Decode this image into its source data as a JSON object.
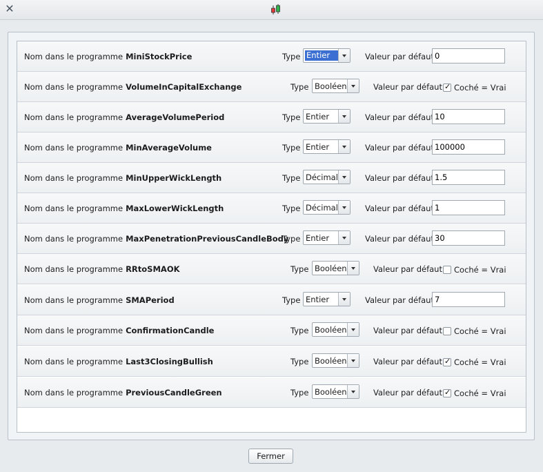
{
  "window": {
    "close_icon": "close-x-icon",
    "app_icon": "candlestick-icon"
  },
  "labels": {
    "name_prefix": "Nom dans le programme",
    "type": "Type",
    "default": "Valeur par défaut",
    "checked_true": "Coché = Vrai"
  },
  "colors": {
    "selection": "#3b6fd1",
    "candle_green": "#2fb34a",
    "candle_red": "#e23b3b"
  },
  "rows": [
    {
      "name": "MiniStockPrice",
      "type": "Entier",
      "value": "0",
      "checked": null,
      "focused": true
    },
    {
      "name": "VolumeInCapitalExchange",
      "type": "Booléen",
      "value": "",
      "checked": true
    },
    {
      "name": "AverageVolumePeriod",
      "type": "Entier",
      "value": "10",
      "checked": null
    },
    {
      "name": "MinAverageVolume",
      "type": "Entier",
      "value": "100000",
      "checked": null
    },
    {
      "name": "MinUpperWickLength",
      "type": "Décimal",
      "value": "1.5",
      "checked": null
    },
    {
      "name": "MaxLowerWickLength",
      "type": "Décimal",
      "value": "1",
      "checked": null
    },
    {
      "name": "MaxPenetrationPreviousCandleBody",
      "type": "Entier",
      "value": "30",
      "checked": null
    },
    {
      "name": "RRtoSMAOK",
      "type": "Booléen",
      "value": "",
      "checked": false
    },
    {
      "name": "SMAPeriod",
      "type": "Entier",
      "value": "7",
      "checked": null
    },
    {
      "name": "ConfirmationCandle",
      "type": "Booléen",
      "value": "",
      "checked": false
    },
    {
      "name": "Last3ClosingBullish",
      "type": "Booléen",
      "value": "",
      "checked": true
    },
    {
      "name": "PreviousCandleGreen",
      "type": "Booléen",
      "value": "",
      "checked": true
    }
  ],
  "footer": {
    "close_button": "Fermer"
  }
}
